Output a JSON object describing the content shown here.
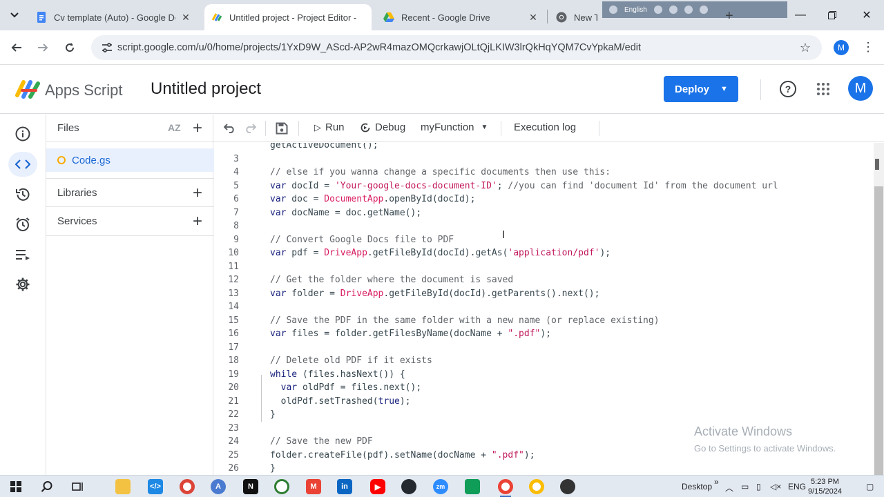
{
  "browser": {
    "tabs": [
      {
        "title": "Cv template (Auto) - Google Doc",
        "favicon": "docs-icon",
        "active": false
      },
      {
        "title": "Untitled project - Project Editor -",
        "favicon": "apps-script-icon",
        "active": true
      },
      {
        "title": "Recent - Google Drive",
        "favicon": "drive-icon",
        "active": false
      },
      {
        "title": "New Tab",
        "favicon": "chrome-icon",
        "active": false
      }
    ],
    "language_bar_label": "English",
    "url": "script.google.com/u/0/home/projects/1YxD9W_AScd-AP2wR4mazOMQcrkawjOLtQjLKIW3lrQkHqYQM7CvYpkaM/edit",
    "profile_initial": "M"
  },
  "header": {
    "product_name": "Apps Script",
    "project_title": "Untitled project",
    "deploy_label": "Deploy",
    "avatar_initial": "M"
  },
  "files_panel": {
    "title": "Files",
    "sort_label": "AZ",
    "files": [
      {
        "name": "Code.gs"
      }
    ],
    "sections": [
      {
        "label": "Libraries"
      },
      {
        "label": "Services"
      }
    ]
  },
  "toolbar": {
    "run_label": "Run",
    "debug_label": "Debug",
    "function_select": "myFunction",
    "execution_log_label": "Execution log"
  },
  "editor": {
    "lines": [
      {
        "n": "",
        "text": "getActiveDocument();"
      },
      {
        "n": "3",
        "text": ""
      },
      {
        "n": "4",
        "text": "// else if you wanna change a specific documents then use this:"
      },
      {
        "n": "5",
        "text": "var docId = 'Your-google-docs-document-ID'; //you can find 'document Id' from the document url"
      },
      {
        "n": "6",
        "text": "var doc = DocumentApp.openById(docId);"
      },
      {
        "n": "7",
        "text": "var docName = doc.getName();"
      },
      {
        "n": "8",
        "text": ""
      },
      {
        "n": "9",
        "text": "// Convert Google Docs file to PDF"
      },
      {
        "n": "10",
        "text": "var pdf = DriveApp.getFileById(docId).getAs('application/pdf');"
      },
      {
        "n": "11",
        "text": ""
      },
      {
        "n": "12",
        "text": "// Get the folder where the document is saved"
      },
      {
        "n": "13",
        "text": "var folder = DriveApp.getFileById(docId).getParents().next();"
      },
      {
        "n": "14",
        "text": ""
      },
      {
        "n": "15",
        "text": "// Save the PDF in the same folder with a new name (or replace existing)"
      },
      {
        "n": "16",
        "text": "var files = folder.getFilesByName(docName + \".pdf\");"
      },
      {
        "n": "17",
        "text": ""
      },
      {
        "n": "18",
        "text": "// Delete old PDF if it exists"
      },
      {
        "n": "19",
        "text": "while (files.hasNext()) {"
      },
      {
        "n": "20",
        "text": "  var oldPdf = files.next();"
      },
      {
        "n": "21",
        "text": "  oldPdf.setTrashed(true);"
      },
      {
        "n": "22",
        "text": "}"
      },
      {
        "n": "23",
        "text": ""
      },
      {
        "n": "24",
        "text": "// Save the new PDF"
      },
      {
        "n": "25",
        "text": "folder.createFile(pdf).setName(docName + \".pdf\");"
      },
      {
        "n": "26",
        "text": "}"
      }
    ]
  },
  "watermark": {
    "title": "Activate Windows",
    "subtitle": "Go to Settings to activate Windows."
  },
  "taskbar": {
    "desktop_label": "Desktop",
    "language": "ENG",
    "time": "5:23 PM",
    "date": "9/15/2024"
  },
  "colors": {
    "accent": "#1a73e8",
    "selected_bg": "#e8f0fe",
    "string": "#c2185b",
    "comment": "#5f6368"
  }
}
